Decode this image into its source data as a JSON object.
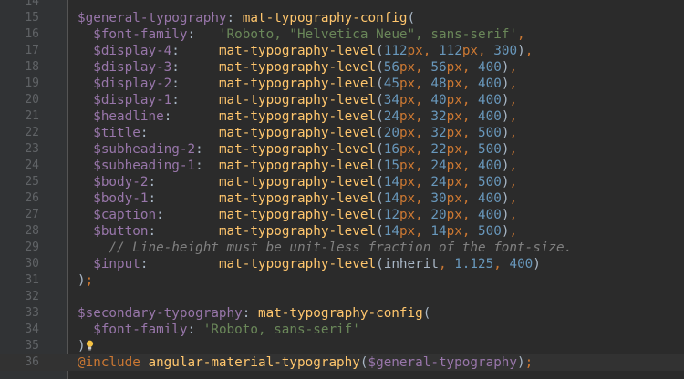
{
  "lines": [
    {
      "n": "14",
      "tokens": []
    },
    {
      "n": "15",
      "tokens": [
        {
          "c": "var",
          "t": "$general-typography"
        },
        {
          "c": "plain",
          "t": ": "
        },
        {
          "c": "fn",
          "t": "mat-typography-config"
        },
        {
          "c": "plain",
          "t": "("
        }
      ]
    },
    {
      "n": "16",
      "tokens": [
        {
          "c": "plain",
          "t": "  "
        },
        {
          "c": "var",
          "t": "$font-family"
        },
        {
          "c": "plain",
          "t": ":   "
        },
        {
          "c": "str",
          "t": "'Roboto, \"Helvetica Neue\", sans-serif'"
        },
        {
          "c": "punct",
          "t": ","
        }
      ]
    },
    {
      "n": "17",
      "tokens": [
        {
          "c": "plain",
          "t": "  "
        },
        {
          "c": "var",
          "t": "$display-4"
        },
        {
          "c": "plain",
          "t": ":     "
        },
        {
          "c": "fn",
          "t": "mat-typography-level"
        },
        {
          "c": "plain",
          "t": "("
        },
        {
          "c": "num",
          "t": "112"
        },
        {
          "c": "unit",
          "t": "px"
        },
        {
          "c": "punct",
          "t": ", "
        },
        {
          "c": "num",
          "t": "112"
        },
        {
          "c": "unit",
          "t": "px"
        },
        {
          "c": "punct",
          "t": ", "
        },
        {
          "c": "num",
          "t": "300"
        },
        {
          "c": "plain",
          "t": ")"
        },
        {
          "c": "punct",
          "t": ","
        }
      ]
    },
    {
      "n": "18",
      "tokens": [
        {
          "c": "plain",
          "t": "  "
        },
        {
          "c": "var",
          "t": "$display-3"
        },
        {
          "c": "plain",
          "t": ":     "
        },
        {
          "c": "fn",
          "t": "mat-typography-level"
        },
        {
          "c": "plain",
          "t": "("
        },
        {
          "c": "num",
          "t": "56"
        },
        {
          "c": "unit",
          "t": "px"
        },
        {
          "c": "punct",
          "t": ", "
        },
        {
          "c": "num",
          "t": "56"
        },
        {
          "c": "unit",
          "t": "px"
        },
        {
          "c": "punct",
          "t": ", "
        },
        {
          "c": "num",
          "t": "400"
        },
        {
          "c": "plain",
          "t": ")"
        },
        {
          "c": "punct",
          "t": ","
        }
      ]
    },
    {
      "n": "19",
      "tokens": [
        {
          "c": "plain",
          "t": "  "
        },
        {
          "c": "var",
          "t": "$display-2"
        },
        {
          "c": "plain",
          "t": ":     "
        },
        {
          "c": "fn",
          "t": "mat-typography-level"
        },
        {
          "c": "plain",
          "t": "("
        },
        {
          "c": "num",
          "t": "45"
        },
        {
          "c": "unit",
          "t": "px"
        },
        {
          "c": "punct",
          "t": ", "
        },
        {
          "c": "num",
          "t": "48"
        },
        {
          "c": "unit",
          "t": "px"
        },
        {
          "c": "punct",
          "t": ", "
        },
        {
          "c": "num",
          "t": "400"
        },
        {
          "c": "plain",
          "t": ")"
        },
        {
          "c": "punct",
          "t": ","
        }
      ]
    },
    {
      "n": "20",
      "tokens": [
        {
          "c": "plain",
          "t": "  "
        },
        {
          "c": "var",
          "t": "$display-1"
        },
        {
          "c": "plain",
          "t": ":     "
        },
        {
          "c": "fn",
          "t": "mat-typography-level"
        },
        {
          "c": "plain",
          "t": "("
        },
        {
          "c": "num",
          "t": "34"
        },
        {
          "c": "unit",
          "t": "px"
        },
        {
          "c": "punct",
          "t": ", "
        },
        {
          "c": "num",
          "t": "40"
        },
        {
          "c": "unit",
          "t": "px"
        },
        {
          "c": "punct",
          "t": ", "
        },
        {
          "c": "num",
          "t": "400"
        },
        {
          "c": "plain",
          "t": ")"
        },
        {
          "c": "punct",
          "t": ","
        }
      ]
    },
    {
      "n": "21",
      "tokens": [
        {
          "c": "plain",
          "t": "  "
        },
        {
          "c": "var",
          "t": "$headline"
        },
        {
          "c": "plain",
          "t": ":      "
        },
        {
          "c": "fn",
          "t": "mat-typography-level"
        },
        {
          "c": "plain",
          "t": "("
        },
        {
          "c": "num",
          "t": "24"
        },
        {
          "c": "unit",
          "t": "px"
        },
        {
          "c": "punct",
          "t": ", "
        },
        {
          "c": "num",
          "t": "32"
        },
        {
          "c": "unit",
          "t": "px"
        },
        {
          "c": "punct",
          "t": ", "
        },
        {
          "c": "num",
          "t": "400"
        },
        {
          "c": "plain",
          "t": ")"
        },
        {
          "c": "punct",
          "t": ","
        }
      ]
    },
    {
      "n": "22",
      "tokens": [
        {
          "c": "plain",
          "t": "  "
        },
        {
          "c": "var",
          "t": "$title"
        },
        {
          "c": "plain",
          "t": ":         "
        },
        {
          "c": "fn",
          "t": "mat-typography-level"
        },
        {
          "c": "plain",
          "t": "("
        },
        {
          "c": "num",
          "t": "20"
        },
        {
          "c": "unit",
          "t": "px"
        },
        {
          "c": "punct",
          "t": ", "
        },
        {
          "c": "num",
          "t": "32"
        },
        {
          "c": "unit",
          "t": "px"
        },
        {
          "c": "punct",
          "t": ", "
        },
        {
          "c": "num",
          "t": "500"
        },
        {
          "c": "plain",
          "t": ")"
        },
        {
          "c": "punct",
          "t": ","
        }
      ]
    },
    {
      "n": "23",
      "tokens": [
        {
          "c": "plain",
          "t": "  "
        },
        {
          "c": "var",
          "t": "$subheading-2"
        },
        {
          "c": "plain",
          "t": ":  "
        },
        {
          "c": "fn",
          "t": "mat-typography-level"
        },
        {
          "c": "plain",
          "t": "("
        },
        {
          "c": "num",
          "t": "16"
        },
        {
          "c": "unit",
          "t": "px"
        },
        {
          "c": "punct",
          "t": ", "
        },
        {
          "c": "num",
          "t": "22"
        },
        {
          "c": "unit",
          "t": "px"
        },
        {
          "c": "punct",
          "t": ", "
        },
        {
          "c": "num",
          "t": "500"
        },
        {
          "c": "plain",
          "t": ")"
        },
        {
          "c": "punct",
          "t": ","
        }
      ]
    },
    {
      "n": "24",
      "tokens": [
        {
          "c": "plain",
          "t": "  "
        },
        {
          "c": "var",
          "t": "$subheading-1"
        },
        {
          "c": "plain",
          "t": ":  "
        },
        {
          "c": "fn",
          "t": "mat-typography-level"
        },
        {
          "c": "plain",
          "t": "("
        },
        {
          "c": "num",
          "t": "15"
        },
        {
          "c": "unit",
          "t": "px"
        },
        {
          "c": "punct",
          "t": ", "
        },
        {
          "c": "num",
          "t": "24"
        },
        {
          "c": "unit",
          "t": "px"
        },
        {
          "c": "punct",
          "t": ", "
        },
        {
          "c": "num",
          "t": "400"
        },
        {
          "c": "plain",
          "t": ")"
        },
        {
          "c": "punct",
          "t": ","
        }
      ]
    },
    {
      "n": "25",
      "tokens": [
        {
          "c": "plain",
          "t": "  "
        },
        {
          "c": "var",
          "t": "$body-2"
        },
        {
          "c": "plain",
          "t": ":        "
        },
        {
          "c": "fn",
          "t": "mat-typography-level"
        },
        {
          "c": "plain",
          "t": "("
        },
        {
          "c": "num",
          "t": "14"
        },
        {
          "c": "unit",
          "t": "px"
        },
        {
          "c": "punct",
          "t": ", "
        },
        {
          "c": "num",
          "t": "24"
        },
        {
          "c": "unit",
          "t": "px"
        },
        {
          "c": "punct",
          "t": ", "
        },
        {
          "c": "num",
          "t": "500"
        },
        {
          "c": "plain",
          "t": ")"
        },
        {
          "c": "punct",
          "t": ","
        }
      ]
    },
    {
      "n": "26",
      "tokens": [
        {
          "c": "plain",
          "t": "  "
        },
        {
          "c": "var",
          "t": "$body-1"
        },
        {
          "c": "plain",
          "t": ":        "
        },
        {
          "c": "fn",
          "t": "mat-typography-level"
        },
        {
          "c": "plain",
          "t": "("
        },
        {
          "c": "num",
          "t": "14"
        },
        {
          "c": "unit",
          "t": "px"
        },
        {
          "c": "punct",
          "t": ", "
        },
        {
          "c": "num",
          "t": "30"
        },
        {
          "c": "unit",
          "t": "px"
        },
        {
          "c": "punct",
          "t": ", "
        },
        {
          "c": "num",
          "t": "400"
        },
        {
          "c": "plain",
          "t": ")"
        },
        {
          "c": "punct",
          "t": ","
        }
      ]
    },
    {
      "n": "27",
      "tokens": [
        {
          "c": "plain",
          "t": "  "
        },
        {
          "c": "var",
          "t": "$caption"
        },
        {
          "c": "plain",
          "t": ":       "
        },
        {
          "c": "fn",
          "t": "mat-typography-level"
        },
        {
          "c": "plain",
          "t": "("
        },
        {
          "c": "num",
          "t": "12"
        },
        {
          "c": "unit",
          "t": "px"
        },
        {
          "c": "punct",
          "t": ", "
        },
        {
          "c": "num",
          "t": "20"
        },
        {
          "c": "unit",
          "t": "px"
        },
        {
          "c": "punct",
          "t": ", "
        },
        {
          "c": "num",
          "t": "400"
        },
        {
          "c": "plain",
          "t": ")"
        },
        {
          "c": "punct",
          "t": ","
        }
      ]
    },
    {
      "n": "28",
      "tokens": [
        {
          "c": "plain",
          "t": "  "
        },
        {
          "c": "var",
          "t": "$button"
        },
        {
          "c": "plain",
          "t": ":        "
        },
        {
          "c": "fn",
          "t": "mat-typography-level"
        },
        {
          "c": "plain",
          "t": "("
        },
        {
          "c": "num",
          "t": "14"
        },
        {
          "c": "unit",
          "t": "px"
        },
        {
          "c": "punct",
          "t": ", "
        },
        {
          "c": "num",
          "t": "14"
        },
        {
          "c": "unit",
          "t": "px"
        },
        {
          "c": "punct",
          "t": ", "
        },
        {
          "c": "num",
          "t": "500"
        },
        {
          "c": "plain",
          "t": ")"
        },
        {
          "c": "punct",
          "t": ","
        }
      ]
    },
    {
      "n": "29",
      "tokens": [
        {
          "c": "plain",
          "t": "    "
        },
        {
          "c": "cm",
          "t": "// Line-height must be unit-less fraction of the font-size."
        }
      ]
    },
    {
      "n": "30",
      "tokens": [
        {
          "c": "plain",
          "t": "  "
        },
        {
          "c": "var",
          "t": "$input"
        },
        {
          "c": "plain",
          "t": ":         "
        },
        {
          "c": "fn",
          "t": "mat-typography-level"
        },
        {
          "c": "plain",
          "t": "(inherit"
        },
        {
          "c": "punct",
          "t": ", "
        },
        {
          "c": "num",
          "t": "1.125"
        },
        {
          "c": "punct",
          "t": ", "
        },
        {
          "c": "num",
          "t": "400"
        },
        {
          "c": "plain",
          "t": ")"
        }
      ]
    },
    {
      "n": "31",
      "tokens": [
        {
          "c": "plain",
          "t": ")"
        },
        {
          "c": "punct",
          "t": ";"
        }
      ]
    },
    {
      "n": "32",
      "tokens": []
    },
    {
      "n": "33",
      "tokens": [
        {
          "c": "var",
          "t": "$secondary-typography"
        },
        {
          "c": "plain",
          "t": ": "
        },
        {
          "c": "fn",
          "t": "mat-typography-config"
        },
        {
          "c": "plain",
          "t": "("
        }
      ]
    },
    {
      "n": "34",
      "tokens": [
        {
          "c": "plain",
          "t": "  "
        },
        {
          "c": "var",
          "t": "$font-family"
        },
        {
          "c": "plain",
          "t": ": "
        },
        {
          "c": "str",
          "t": "'Roboto, sans-serif'"
        }
      ]
    },
    {
      "n": "35",
      "tokens": [
        {
          "c": "plain",
          "t": ")"
        }
      ],
      "bulb": true
    },
    {
      "n": "36",
      "tokens": [
        {
          "c": "kw",
          "t": "@include "
        },
        {
          "c": "fn",
          "t": "angular-material-typography"
        },
        {
          "c": "plain",
          "t": "("
        },
        {
          "c": "var",
          "t": "$general-typography"
        },
        {
          "c": "plain",
          "t": ")"
        },
        {
          "c": "punct",
          "t": ";"
        }
      ],
      "current": true
    }
  ],
  "icons": {
    "intention": "lightbulb-icon"
  },
  "colors": {
    "background": "#2b2b2b",
    "gutter": "#313335",
    "variable": "#9876aa",
    "function": "#ffc66d",
    "number": "#6897bb",
    "keyword": "#cc7832",
    "string": "#6a8759",
    "comment": "#808080",
    "text": "#a9b7c6"
  }
}
